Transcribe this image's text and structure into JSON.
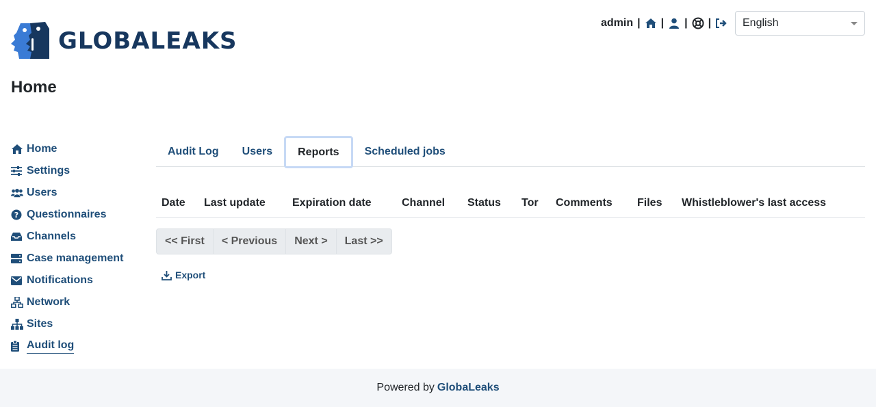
{
  "brand": {
    "name": "GLOBALEAKS",
    "logo_icon": "globaleaks-logo-icon"
  },
  "topbar": {
    "user": "admin",
    "separator": "|",
    "icons": [
      "home-icon",
      "user-icon",
      "support-icon",
      "logout-icon"
    ]
  },
  "language": {
    "selected": "English"
  },
  "page": {
    "title": "Home"
  },
  "sidebar": {
    "items": [
      {
        "label": "Home",
        "icon": "home-icon"
      },
      {
        "label": "Settings",
        "icon": "sliders-icon"
      },
      {
        "label": "Users",
        "icon": "users-icon"
      },
      {
        "label": "Questionnaires",
        "icon": "question-circle-icon"
      },
      {
        "label": "Channels",
        "icon": "inbox-icon"
      },
      {
        "label": "Case management",
        "icon": "server-icon"
      },
      {
        "label": "Notifications",
        "icon": "envelope-icon"
      },
      {
        "label": "Network",
        "icon": "network-icon"
      },
      {
        "label": "Sites",
        "icon": "sitemap-icon"
      },
      {
        "label": "Audit log",
        "icon": "clipboard-icon"
      }
    ]
  },
  "tabs": [
    {
      "label": "Audit Log"
    },
    {
      "label": "Users"
    },
    {
      "label": "Reports"
    },
    {
      "label": "Scheduled jobs"
    }
  ],
  "table": {
    "columns": [
      "Date",
      "Last update",
      "Expiration date",
      "Channel",
      "Status",
      "Tor",
      "Comments",
      "Files",
      "Whistleblower's last access"
    ]
  },
  "pager": {
    "first": "<< First",
    "previous": "< Previous",
    "next": "Next >",
    "last": "Last >>"
  },
  "export": {
    "label": "Export",
    "icon": "download-icon"
  },
  "footer": {
    "prefix": "Powered by",
    "link": "GlobaLeaks"
  },
  "colors": {
    "brand": "#17375e",
    "link": "#1f4e79",
    "accent": "#3a7bd5",
    "footer_bg": "#f4f6f9"
  }
}
